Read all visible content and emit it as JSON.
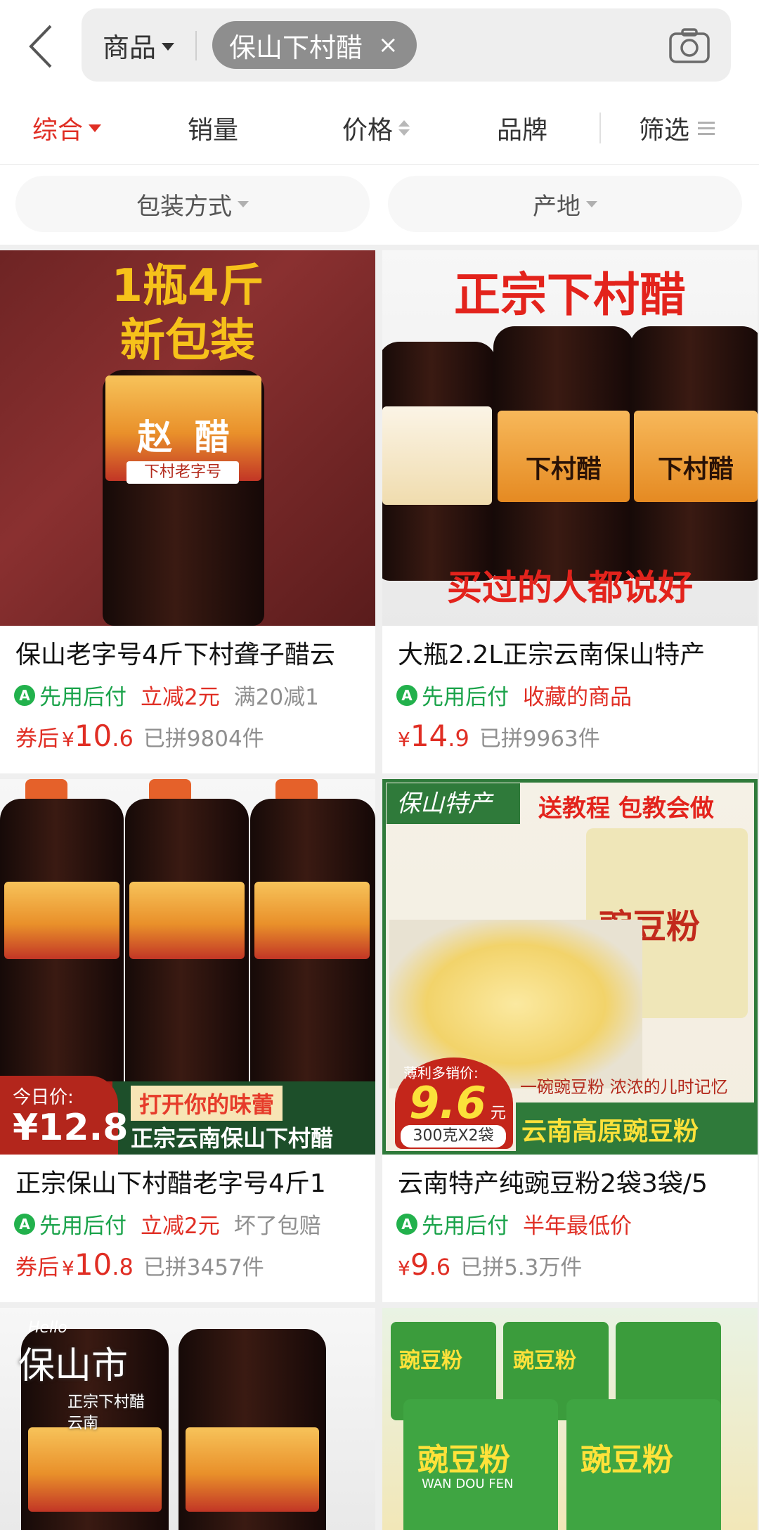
{
  "header": {
    "scope_label": "商品",
    "query_chip": "保山下村醋",
    "chip_close": "×"
  },
  "sort": {
    "items": [
      {
        "label": "综合",
        "active": true
      },
      {
        "label": "销量"
      },
      {
        "label": "价格"
      },
      {
        "label": "品牌"
      },
      {
        "label": "筛选"
      }
    ]
  },
  "filters": [
    {
      "label": "包装方式"
    },
    {
      "label": "产地"
    }
  ],
  "products": [
    {
      "title": "保山老字号4斤下村聋子醋云",
      "pay_label": "先用后付",
      "tags": [
        {
          "text": "立减2元",
          "style": "red"
        },
        {
          "text": "满20减1",
          "style": "gray"
        }
      ],
      "price_prefix": "券后",
      "currency": "¥",
      "price_int": "10",
      "price_dec": ".6",
      "sold": "已拼9804件",
      "img_text": [
        "1瓶4斤",
        "新包装"
      ],
      "label_text": [
        "赵",
        "醋"
      ],
      "label_sub": "下村老字号"
    },
    {
      "title": "大瓶2.2L正宗云南保山特产",
      "pay_label": "先用后付",
      "tags": [
        {
          "text": "收藏的商品",
          "style": "red"
        }
      ],
      "price_prefix": "",
      "currency": "¥",
      "price_int": "14",
      "price_dec": ".9",
      "sold": "已拼9963件",
      "img_text": [
        "正宗下村醋",
        "买过的人都说好"
      ],
      "label_text": [
        "下村醋"
      ]
    },
    {
      "title": "正宗保山下村醋老字号4斤1",
      "pay_label": "先用后付",
      "tags": [
        {
          "text": "立减2元",
          "style": "red"
        },
        {
          "text": "坏了包赔",
          "style": "gray"
        }
      ],
      "price_prefix": "券后",
      "currency": "¥",
      "price_int": "10",
      "price_dec": ".8",
      "sold": "已拼3457件",
      "img_text": [
        "今日价:",
        "¥12.8",
        "打开你的味蕾",
        "正宗云南保山下村醋"
      ]
    },
    {
      "title": "云南特产纯豌豆粉2袋3袋/5",
      "pay_label": "先用后付",
      "tags": [
        {
          "text": "半年最低价",
          "style": "red"
        }
      ],
      "price_prefix": "",
      "currency": "¥",
      "price_int": "9",
      "price_dec": ".6",
      "sold": "已拼5.3万件",
      "img_text": [
        "保山特产",
        "送教程 包教会做",
        "豌豆粉",
        "薄利多销价:",
        "9.6",
        "元",
        "300克X2袋",
        "一碗豌豆粉 浓浓的儿时记忆",
        "云南高原豌豆粉"
      ]
    },
    {
      "img_text": [
        "Hello",
        "保山市",
        "正宗下村醋",
        "云南"
      ]
    },
    {
      "img_text": [
        "豌豆粉",
        "豌豆粉",
        "豌豆粉",
        "豌豆粉",
        "WAN DOU FEN"
      ]
    }
  ]
}
